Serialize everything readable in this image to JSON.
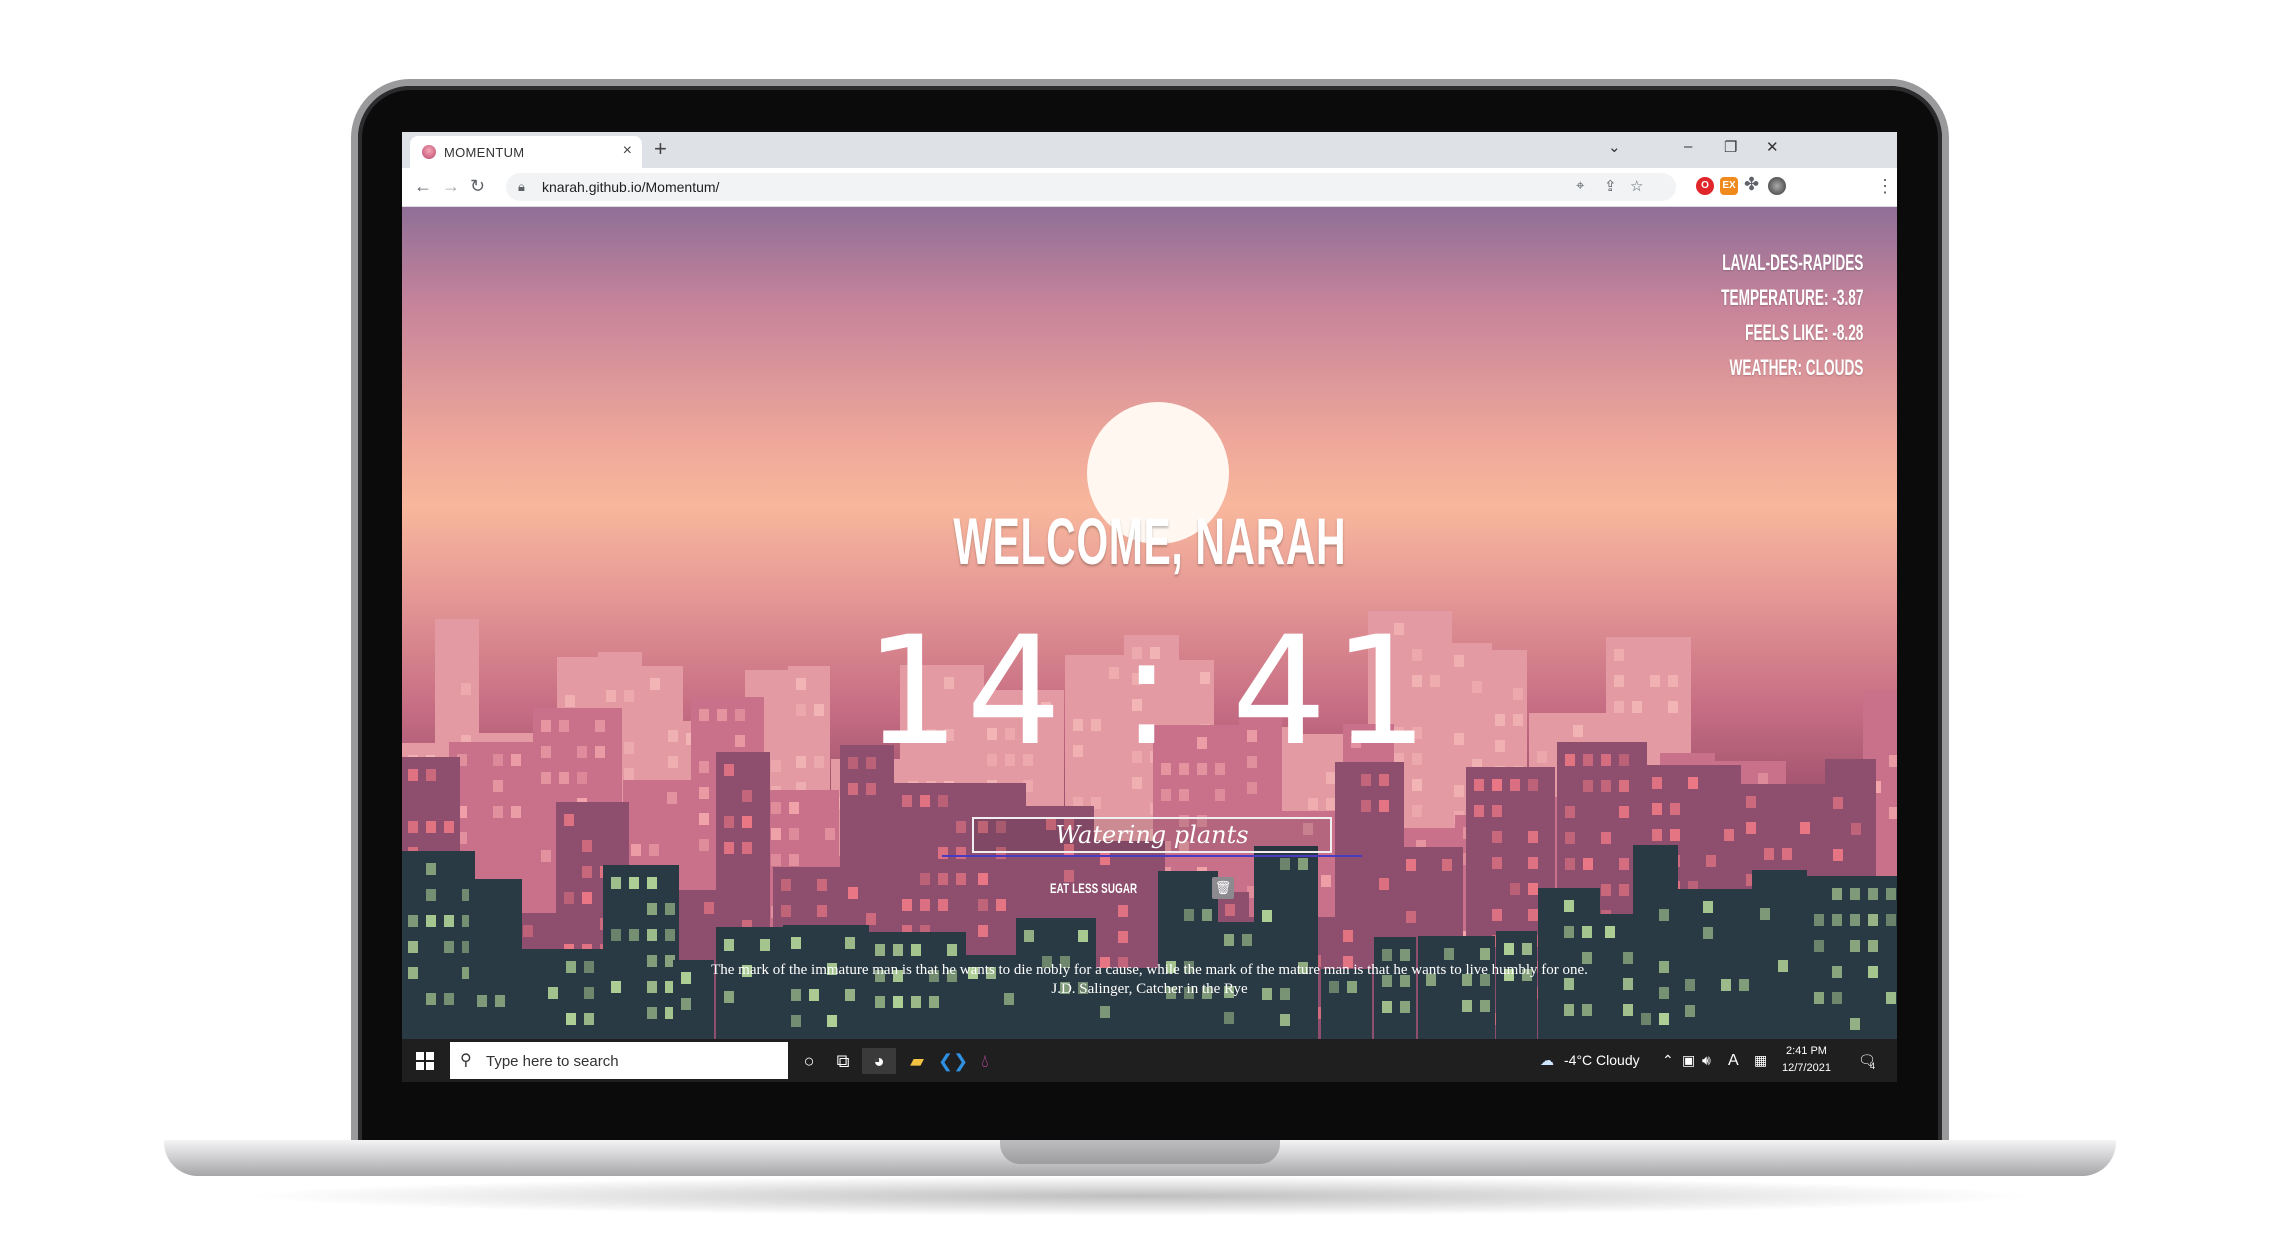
{
  "browser": {
    "tab_title": "MOMENTUM",
    "tab_close": "×",
    "new_tab": "+",
    "url": "knarah.github.io/Momentum/",
    "ext_badge": "EX"
  },
  "weather": {
    "city": "LAVAL-DES-RAPIDES",
    "temperature": "TEMPERATURE: -3.87",
    "feels_like": "FEELS LIKE: -8.28",
    "condition": "WEATHER: CLOUDS"
  },
  "greeting": "WELCOME, NARAH",
  "clock": "14 : 41",
  "focus": "Watering plants",
  "todo": {
    "item": "EAT LESS SUGAR"
  },
  "quote": {
    "text": "The mark of the immature man is that he wants to die nobly for a cause, while the mark of the mature man is that he wants to live humbly for one.",
    "source": "J.D. Salinger, Catcher in the Rye"
  },
  "taskbar": {
    "search_placeholder": "Type here to search",
    "weather": "-4°C  Cloudy",
    "lang": "A",
    "time": "2:41 PM",
    "date": "12/7/2021",
    "notifications": "4"
  },
  "colors": {
    "focus_underline": "#4a3cc2",
    "sky_top": "#8f6f98",
    "sky_glow": "#f8b79c"
  }
}
